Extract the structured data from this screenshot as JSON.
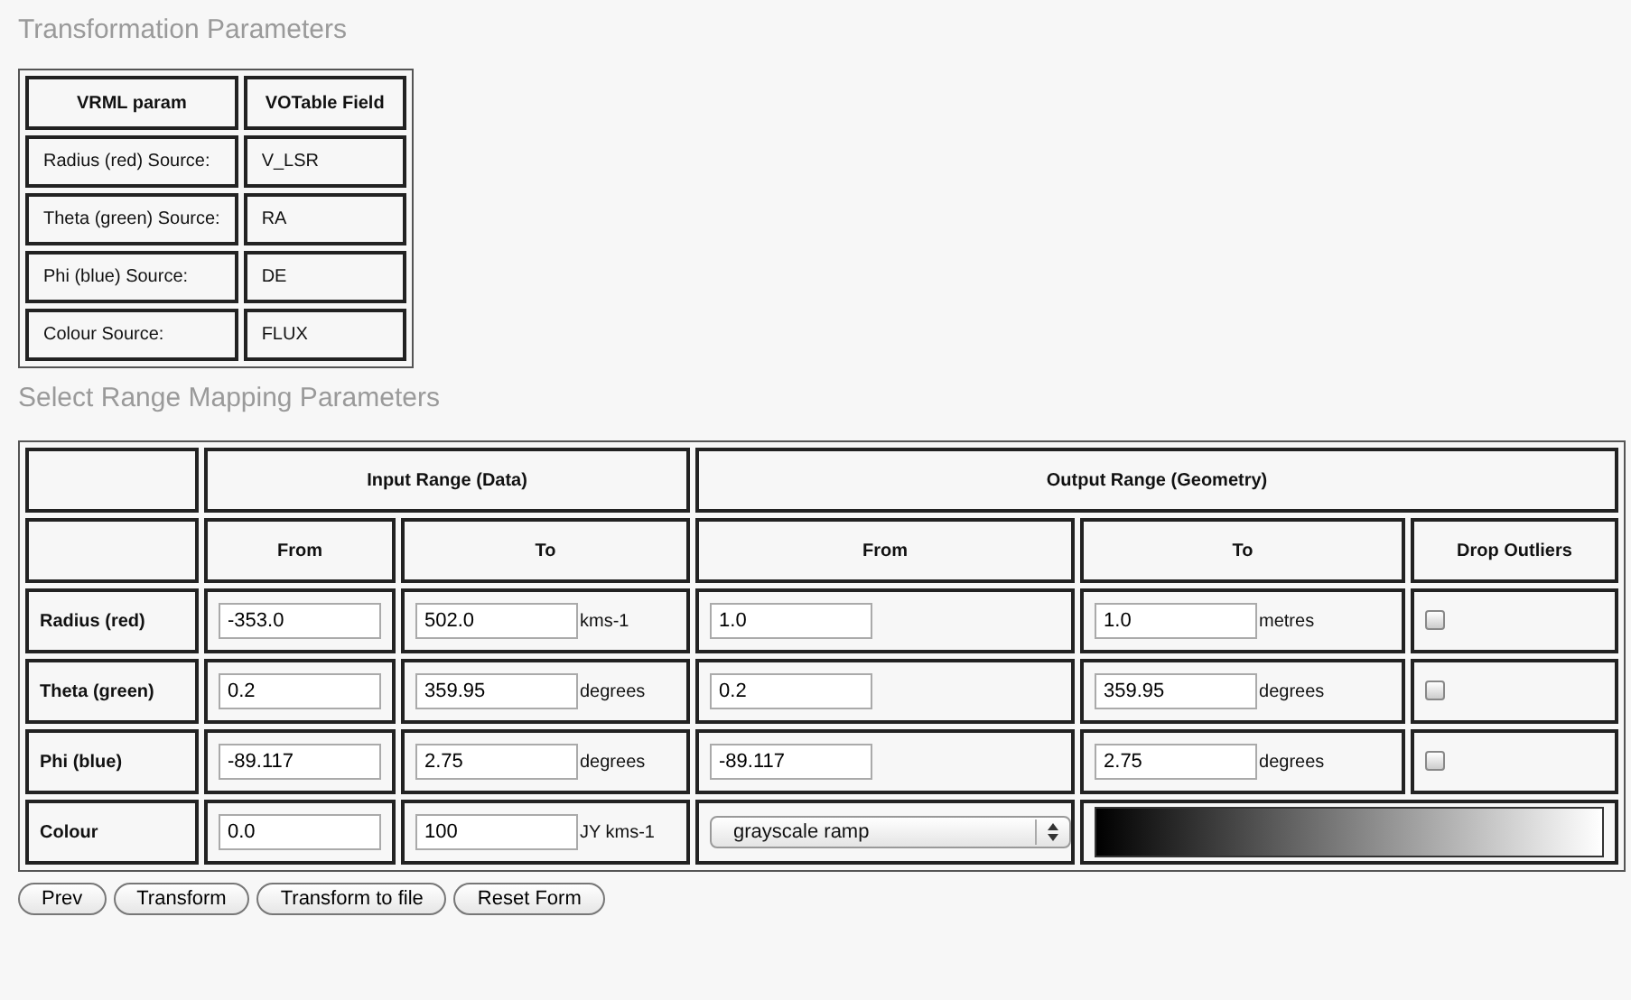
{
  "transformation": {
    "title": "Transformation Parameters",
    "columns": [
      "VRML param",
      "VOTable Field"
    ],
    "rows": [
      {
        "param": "Radius (red) Source:",
        "field": "V_LSR"
      },
      {
        "param": "Theta (green) Source:",
        "field": "RA"
      },
      {
        "param": "Phi (blue) Source:",
        "field": "DE"
      },
      {
        "param": "Colour Source:",
        "field": "FLUX"
      }
    ]
  },
  "range_mapping": {
    "title": "Select Range Mapping Parameters",
    "groups": [
      "Input Range (Data)",
      "Output Range (Geometry)"
    ],
    "columns": [
      "From",
      "To",
      "From",
      "To",
      "Drop Outliers"
    ],
    "rows": [
      {
        "kind": "axis",
        "name": "Radius (red)",
        "in_from": "-353.0",
        "in_to": "502.0",
        "in_unit": "kms-1",
        "out_from": "1.0",
        "out_to": "1.0",
        "out_unit": "metres",
        "drop_outliers": false
      },
      {
        "kind": "axis",
        "name": "Theta (green)",
        "in_from": "0.2",
        "in_to": "359.95",
        "in_unit": "degrees",
        "out_from": "0.2",
        "out_to": "359.95",
        "out_unit": "degrees",
        "drop_outliers": false
      },
      {
        "kind": "axis",
        "name": "Phi (blue)",
        "in_from": "-89.117",
        "in_to": "2.75",
        "in_unit": "degrees",
        "out_from": "-89.117",
        "out_to": "2.75",
        "out_unit": "degrees",
        "drop_outliers": false
      },
      {
        "kind": "colour",
        "name": "Colour",
        "in_from": "0.0",
        "in_to": "100",
        "in_unit": "JY kms-1",
        "colour_map": "grayscale ramp"
      }
    ]
  },
  "buttons": [
    "Prev",
    "Transform",
    "Transform to file",
    "Reset Form"
  ]
}
